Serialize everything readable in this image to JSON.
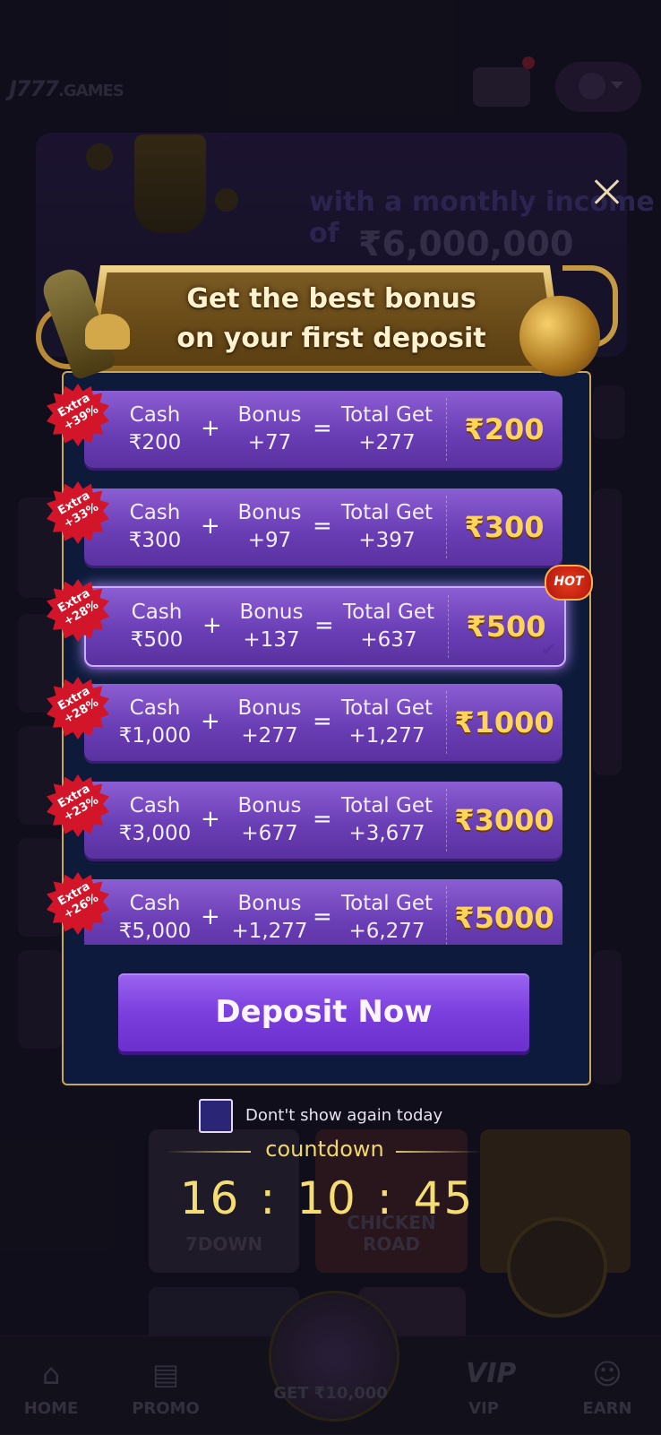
{
  "app": {
    "logo": "J777",
    "logo_suffix": ".GAMES"
  },
  "banner": {
    "line1": "with a monthly income of",
    "line2": "₹6,000,000"
  },
  "modal": {
    "title_line1": "Get the best bonus",
    "title_line2": "on your first deposit",
    "labels": {
      "cash": "Cash",
      "bonus": "Bonus",
      "total": "Total Get",
      "plus": "+",
      "equals": "="
    },
    "hot_label": "HOT",
    "rows": [
      {
        "extra": "Extra\n+39%",
        "cash": "₹200",
        "bonus": "+77",
        "total": "+277",
        "amount": "₹200",
        "selected": false
      },
      {
        "extra": "Extra\n+33%",
        "cash": "₹300",
        "bonus": "+97",
        "total": "+397",
        "amount": "₹300",
        "selected": false
      },
      {
        "extra": "Extra\n+28%",
        "cash": "₹500",
        "bonus": "+137",
        "total": "+637",
        "amount": "₹500",
        "selected": true
      },
      {
        "extra": "Extra\n+28%",
        "cash": "₹1,000",
        "bonus": "+277",
        "total": "+1,277",
        "amount": "₹1000",
        "selected": false
      },
      {
        "extra": "Extra\n+23%",
        "cash": "₹3,000",
        "bonus": "+677",
        "total": "+3,677",
        "amount": "₹3000",
        "selected": false
      },
      {
        "extra": "Extra\n+26%",
        "cash": "₹5,000",
        "bonus": "+1,277",
        "total": "+6,277",
        "amount": "₹5000",
        "selected": false
      }
    ],
    "deposit_button": "Deposit Now",
    "dont_show": "Dont't show again today",
    "countdown_label": "countdown",
    "timer": {
      "h": "16",
      "m": "10",
      "s": "45",
      "sep": ":"
    }
  },
  "bottom_nav": {
    "home": "HOME",
    "promo": "PROMO",
    "center": "GET ₹10,000",
    "vip": "VIP",
    "earn": "EARN"
  },
  "background_tiles": {
    "dice_label": "7DOWN",
    "chicken_label": "CHICKEN ROAD"
  },
  "colors": {
    "accent_gold": "#ffd45a",
    "row_purple": "#7b4ac8",
    "panel_navy": "#0d1a3a",
    "badge_red": "#d3152a",
    "button_purple": "#7b3fde"
  }
}
